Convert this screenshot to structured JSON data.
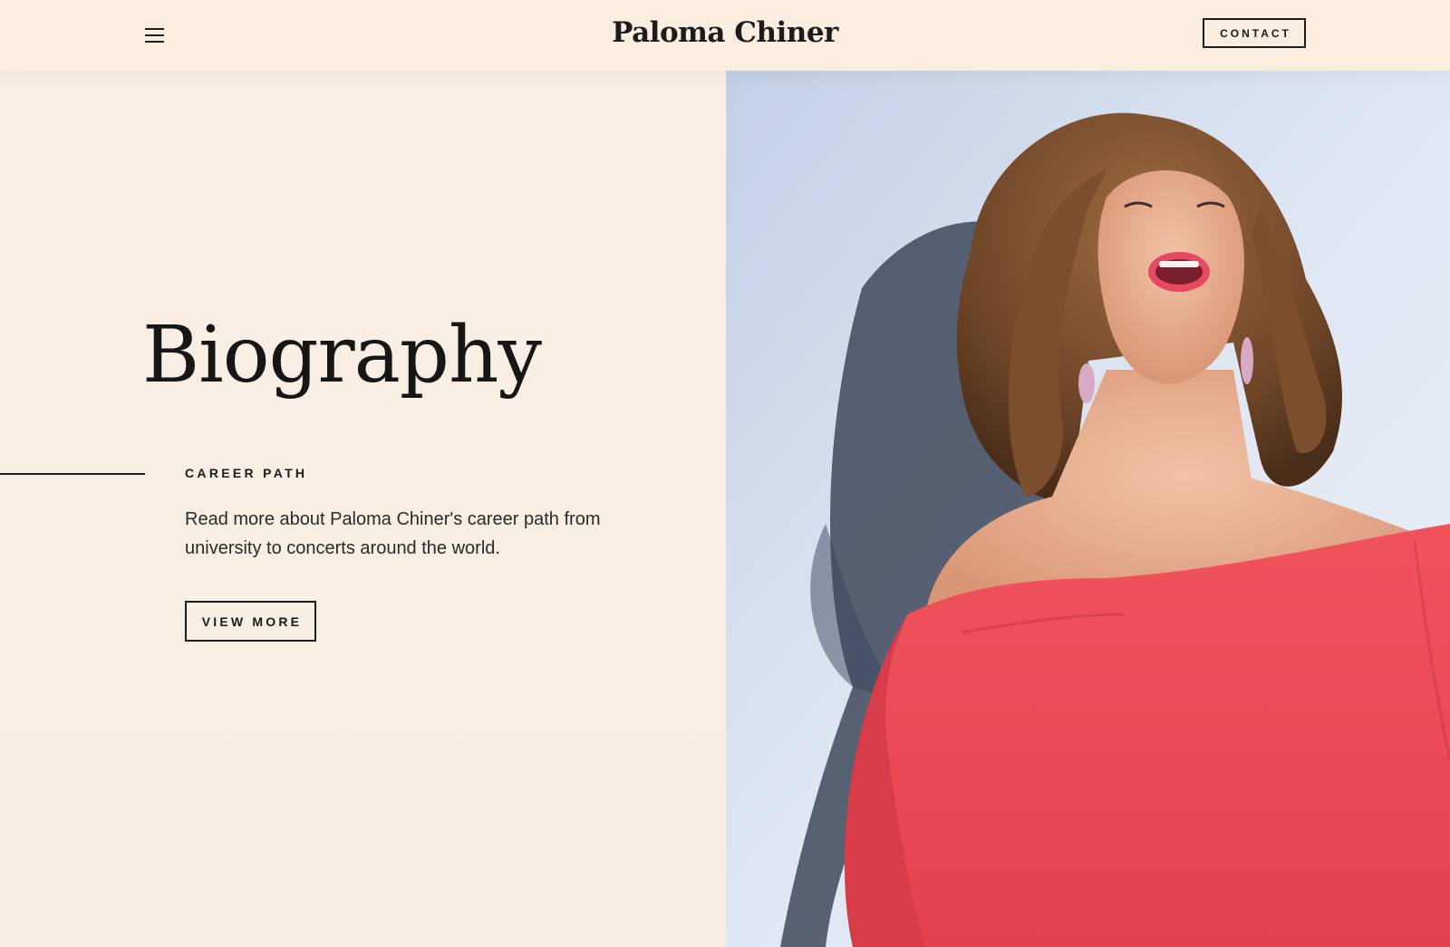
{
  "header": {
    "brand": "Paloma Chiner",
    "contact_label": "CONTACT",
    "menu_icon": "hamburger-menu-icon"
  },
  "hero": {
    "title": "Biography",
    "eyebrow": "CAREER PATH",
    "description": "Read more about Paloma Chiner's career path from university to concerts around the world.",
    "button_label": "VIEW MORE"
  },
  "photo": {
    "subject": "woman in red off-shoulder dress laughing"
  },
  "colors": {
    "background": "#f9eee3",
    "text": "#1c1c1c",
    "dress_red": "#ec4f5a"
  }
}
